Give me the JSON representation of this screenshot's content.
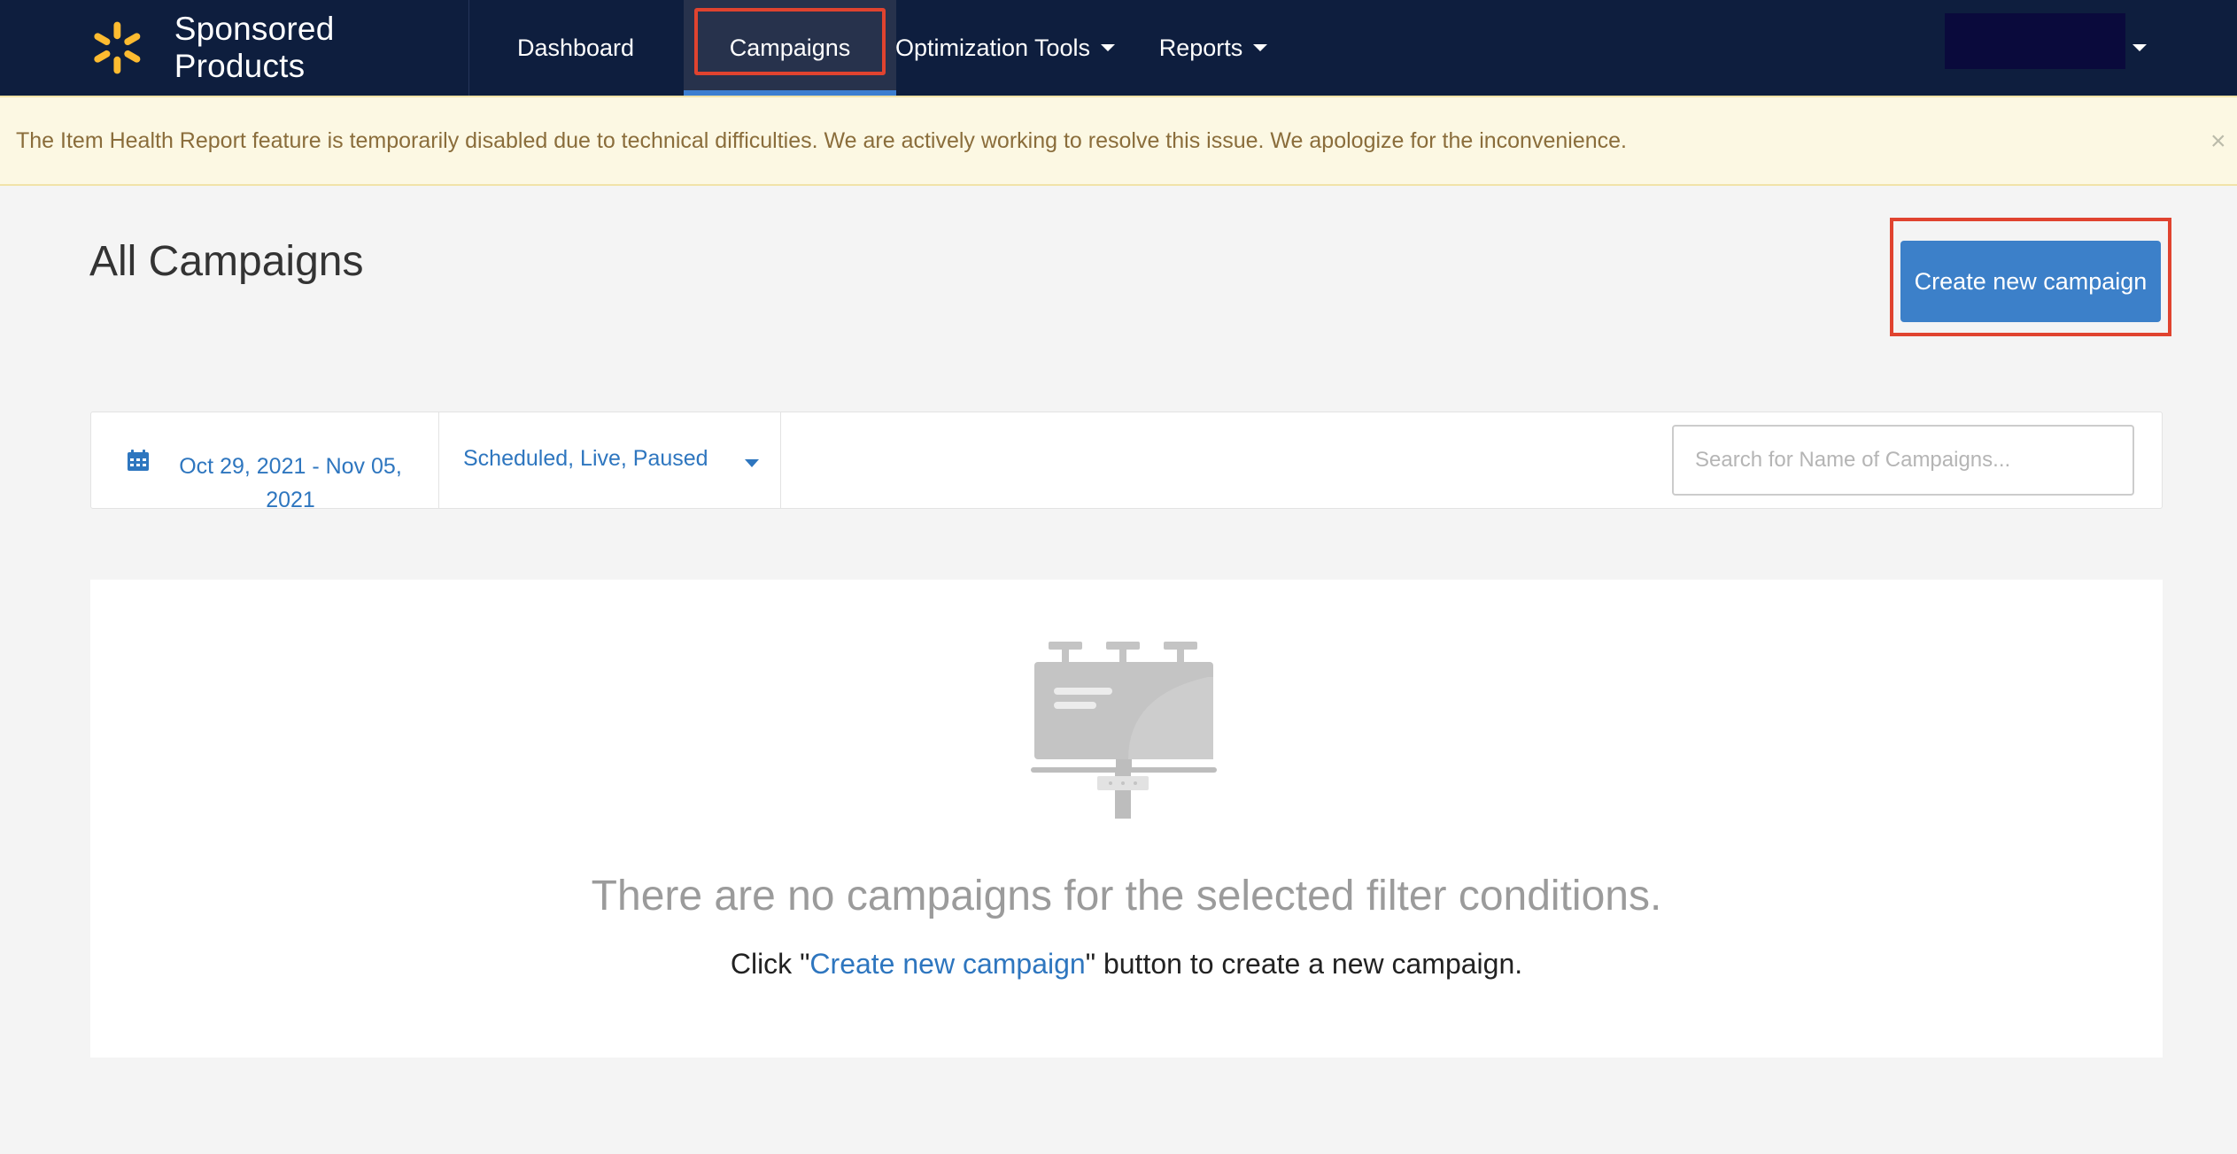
{
  "nav": {
    "brand_name": "Sponsored Products",
    "items": [
      {
        "label": "Dashboard"
      },
      {
        "label": "Campaigns",
        "active": true
      },
      {
        "label": "Optimization Tools"
      },
      {
        "label": "Reports"
      }
    ]
  },
  "alert": {
    "text": "The Item Health Report feature is temporarily disabled due to technical difficulties. We are actively working to resolve this issue. We apologize for the inconvenience.",
    "close_glyph": "×"
  },
  "page": {
    "title": "All Campaigns",
    "create_button_label": "Create new campaign"
  },
  "filters": {
    "date_range": "Oct 29, 2021 - Nov 05, 2021",
    "status": "Scheduled, Live, Paused",
    "search_placeholder": "Search for Name of Campaigns..."
  },
  "empty_state": {
    "title": "There are no campaigns for the selected filter conditions.",
    "sub_prefix": "Click \"",
    "sub_link": "Create new campaign",
    "sub_suffix": "\" button to create a new campaign."
  },
  "colors": {
    "nav_bg": "#0e1e3e",
    "accent": "#3c80c9",
    "link": "#2e76bf",
    "highlight": "#e0432f",
    "alert_bg": "#fcf8e3",
    "brand_spark": "#fdbb30"
  },
  "icons": {
    "brand": "walmart-spark-icon",
    "calendar": "calendar-icon",
    "empty": "billboard-icon"
  }
}
